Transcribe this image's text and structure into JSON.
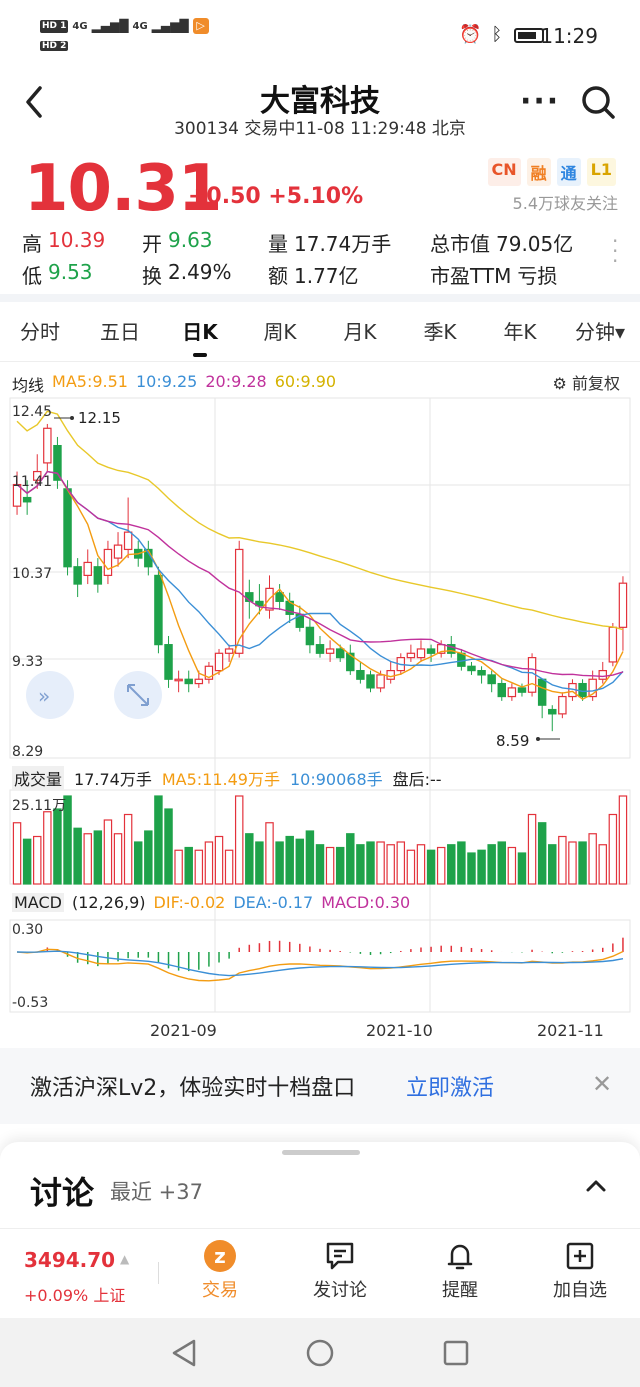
{
  "status": {
    "sim1": "HD 1",
    "sim2": "HD 2",
    "signal": "4G",
    "time": "11:29"
  },
  "header": {
    "stock_name": "大富科技",
    "subtitle": "300134 交易中11-08 11:29:48 北京"
  },
  "quote": {
    "price": "10.31",
    "change": "+0.50 +5.10%",
    "badges": [
      {
        "label": "CN",
        "color": "#e8552a",
        "bg": "#fdeee8"
      },
      {
        "label": "融",
        "color": "#f07f23",
        "bg": "#fdf1e6"
      },
      {
        "label": "通",
        "color": "#2f86e0",
        "bg": "#e8f2fc"
      },
      {
        "label": "L1",
        "color": "#d9a400",
        "bg": "#fdf7df"
      }
    ],
    "followers": "5.4万球友关注",
    "stats": {
      "high_label": "高",
      "high": "10.39",
      "open_label": "开",
      "open": "9.63",
      "vol_label": "量",
      "vol": "17.74万手",
      "mcap_label": "总市值",
      "mcap": "79.05亿",
      "low_label": "低",
      "low": "9.53",
      "turn_label": "换",
      "turn": "2.49%",
      "amt_label": "额",
      "amt": "1.77亿",
      "pe_label": "市盈TTM",
      "pe": "亏损"
    }
  },
  "tabs": [
    "分时",
    "五日",
    "日K",
    "周K",
    "月K",
    "季K",
    "年K",
    "分钟▾"
  ],
  "active_tab": 2,
  "ma": {
    "label": "均线",
    "ma5": "MA5:9.51",
    "ma10": "10:9.25",
    "ma20": "20:9.28",
    "ma60": "60:9.90",
    "adjust": "前复权",
    "colors": {
      "ma5": "#f39c12",
      "ma10": "#3b8fd6",
      "ma20": "#c0329c",
      "ma60": "#e8c82a"
    }
  },
  "price_axis": [
    "12.45",
    "11.41",
    "10.37",
    "9.33",
    "8.29"
  ],
  "marks": {
    "high": "12.15",
    "low": "8.59"
  },
  "volume": {
    "label": "成交量",
    "vol": "17.74万手",
    "ma5": "MA5:11.49万手",
    "ma10": "10:90068手",
    "after": "盘后:--",
    "axis_max": "25.11万"
  },
  "macd": {
    "label": "MACD",
    "params": "(12,26,9)",
    "dif": "DIF:-0.02",
    "dea": "DEA:-0.17",
    "macd": "MACD:0.30",
    "axis_top": "0.30",
    "axis_bottom": "-0.53"
  },
  "dates": [
    "2021-09",
    "2021-10",
    "2021-11"
  ],
  "banner": {
    "text": "激活沪深Lv2，体验实时十档盘口",
    "link": "立即激活"
  },
  "discussion": {
    "title": "讨论",
    "sub": "最近 +37"
  },
  "bottom": {
    "index_value": "3494.70",
    "index_change": "+0.09% 上证",
    "buttons": [
      "交易",
      "发讨论",
      "提醒",
      "加自选"
    ]
  },
  "chart_data": {
    "type": "candlestick",
    "candles": [
      [
        11.2,
        11.45,
        11.6,
        11.1
      ],
      [
        11.3,
        11.25,
        11.5,
        11.1
      ],
      [
        11.5,
        11.6,
        11.8,
        11.4
      ],
      [
        11.7,
        12.1,
        12.15,
        11.6
      ],
      [
        11.9,
        11.5,
        12.0,
        11.4
      ],
      [
        11.4,
        10.5,
        11.5,
        10.4
      ],
      [
        10.5,
        10.3,
        10.6,
        10.15
      ],
      [
        10.4,
        10.55,
        10.7,
        10.3
      ],
      [
        10.5,
        10.3,
        10.6,
        10.2
      ],
      [
        10.4,
        10.7,
        10.8,
        10.3
      ],
      [
        10.6,
        10.75,
        10.9,
        10.5
      ],
      [
        10.7,
        10.9,
        11.3,
        10.6
      ],
      [
        10.7,
        10.6,
        10.8,
        10.5
      ],
      [
        10.7,
        10.5,
        10.8,
        10.4
      ],
      [
        10.4,
        9.6,
        10.5,
        9.5
      ],
      [
        9.6,
        9.2,
        9.7,
        9.1
      ],
      [
        9.2,
        9.2,
        9.3,
        9.05
      ],
      [
        9.2,
        9.15,
        9.3,
        9.05
      ],
      [
        9.15,
        9.2,
        9.3,
        9.1
      ],
      [
        9.2,
        9.35,
        9.4,
        9.15
      ],
      [
        9.3,
        9.5,
        9.55,
        9.25
      ],
      [
        9.5,
        9.55,
        9.6,
        9.4
      ],
      [
        9.5,
        10.7,
        10.8,
        9.45
      ],
      [
        10.2,
        10.1,
        10.35,
        9.9
      ],
      [
        10.1,
        10.05,
        10.3,
        9.95
      ],
      [
        10.0,
        10.25,
        10.4,
        9.9
      ],
      [
        10.2,
        10.1,
        10.3,
        10.0
      ],
      [
        10.1,
        9.95,
        10.2,
        9.85
      ],
      [
        9.95,
        9.8,
        10.05,
        9.75
      ],
      [
        9.8,
        9.6,
        9.9,
        9.5
      ],
      [
        9.6,
        9.5,
        9.7,
        9.45
      ],
      [
        9.5,
        9.55,
        9.65,
        9.4
      ],
      [
        9.55,
        9.45,
        9.6,
        9.4
      ],
      [
        9.5,
        9.3,
        9.6,
        9.25
      ],
      [
        9.3,
        9.2,
        9.4,
        9.15
      ],
      [
        9.25,
        9.1,
        9.3,
        9.05
      ],
      [
        9.1,
        9.25,
        9.3,
        9.05
      ],
      [
        9.2,
        9.3,
        9.4,
        9.15
      ],
      [
        9.3,
        9.45,
        9.5,
        9.25
      ],
      [
        9.45,
        9.5,
        9.6,
        9.4
      ],
      [
        9.45,
        9.55,
        9.65,
        9.4
      ],
      [
        9.55,
        9.5,
        9.6,
        9.4
      ],
      [
        9.5,
        9.6,
        9.65,
        9.45
      ],
      [
        9.6,
        9.5,
        9.7,
        9.45
      ],
      [
        9.5,
        9.35,
        9.55,
        9.3
      ],
      [
        9.35,
        9.3,
        9.4,
        9.25
      ],
      [
        9.3,
        9.25,
        9.35,
        9.15
      ],
      [
        9.25,
        9.15,
        9.3,
        9.05
      ],
      [
        9.15,
        9.0,
        9.2,
        8.95
      ],
      [
        9.0,
        9.1,
        9.15,
        8.95
      ],
      [
        9.1,
        9.05,
        9.15,
        9.0
      ],
      [
        9.05,
        9.45,
        9.5,
        9.0
      ],
      [
        9.2,
        8.9,
        9.2,
        8.75
      ],
      [
        8.85,
        8.8,
        8.9,
        8.6
      ],
      [
        8.8,
        9.0,
        9.05,
        8.75
      ],
      [
        9.0,
        9.15,
        9.2,
        8.95
      ],
      [
        9.15,
        9.0,
        9.2,
        8.95
      ],
      [
        9.0,
        9.2,
        9.3,
        8.95
      ],
      [
        9.2,
        9.3,
        9.4,
        9.15
      ],
      [
        9.4,
        9.8,
        9.85,
        9.35
      ],
      [
        9.8,
        10.31,
        10.39,
        9.53
      ]
    ],
    "price_range": [
      8.29,
      12.45
    ]
  }
}
